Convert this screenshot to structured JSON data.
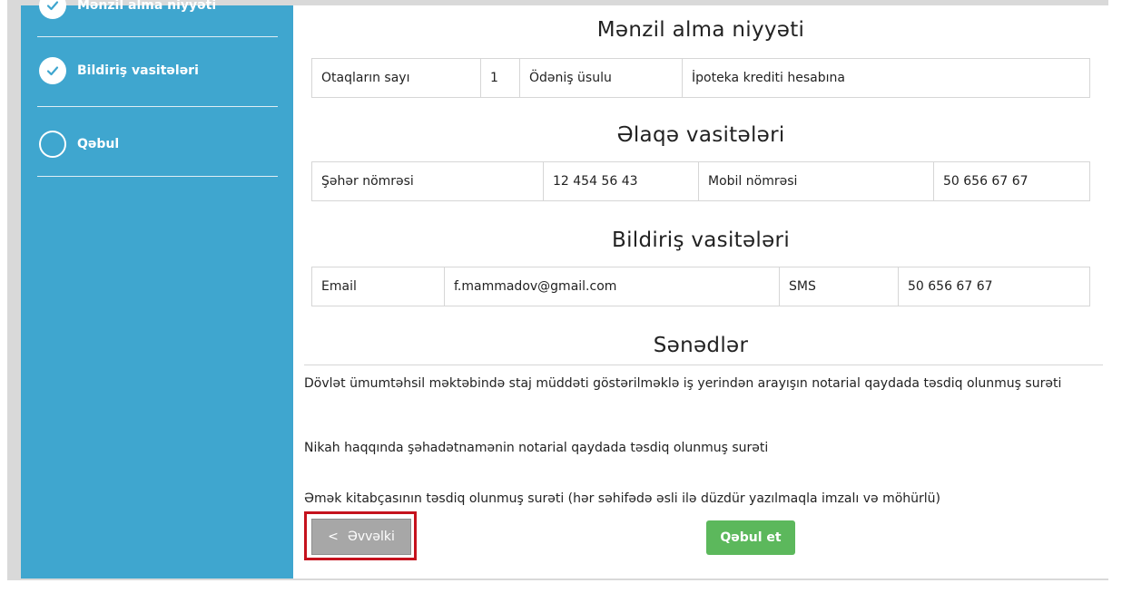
{
  "sidebar": {
    "items": [
      {
        "label": "Mənzil alma niyyəti",
        "state": "done"
      },
      {
        "label": "Bildiriş vasitələri",
        "state": "done"
      },
      {
        "label": "Qəbul",
        "state": "pending"
      }
    ]
  },
  "sections": {
    "housing": {
      "title": "Mənzil alma niyyəti",
      "row": [
        "Otaqların sayı",
        "1",
        "Ödəniş üsulu",
        "İpoteka krediti hesabına"
      ]
    },
    "contact": {
      "title": "Əlaqə vasitələri",
      "row": [
        "Şəhər nömrəsi",
        "12 454 56 43",
        "Mobil nömrəsi",
        "50 656 67 67"
      ]
    },
    "notify": {
      "title": "Bildiriş vasitələri",
      "row": [
        "Email",
        "f.mammadov@gmail.com",
        "SMS",
        "50 656 67 67"
      ]
    },
    "documents": {
      "title": "Sənədlər",
      "items": [
        "Dövlət ümumtəhsil məktəbində staj müddəti göstərilməklə iş yerindən arayışın notarial qaydada təsdiq olunmuş surəti",
        "Nikah haqqında şəhadətnamənin notarial qaydada təsdiq olunmuş surəti",
        "Əmək kitabçasının təsdiq olunmuş surəti (hər səhifədə əsli ilə düzdür yazılmaqla imzalı və möhürlü)"
      ]
    }
  },
  "buttons": {
    "prev_icon": "<",
    "prev_label": "Əvvəlki",
    "accept_label": "Qəbul et"
  },
  "colors": {
    "sidebar": "#3fa6cf",
    "accept": "#5cb85c",
    "prev": "#a7a7a7",
    "highlight": "#c5121d"
  }
}
